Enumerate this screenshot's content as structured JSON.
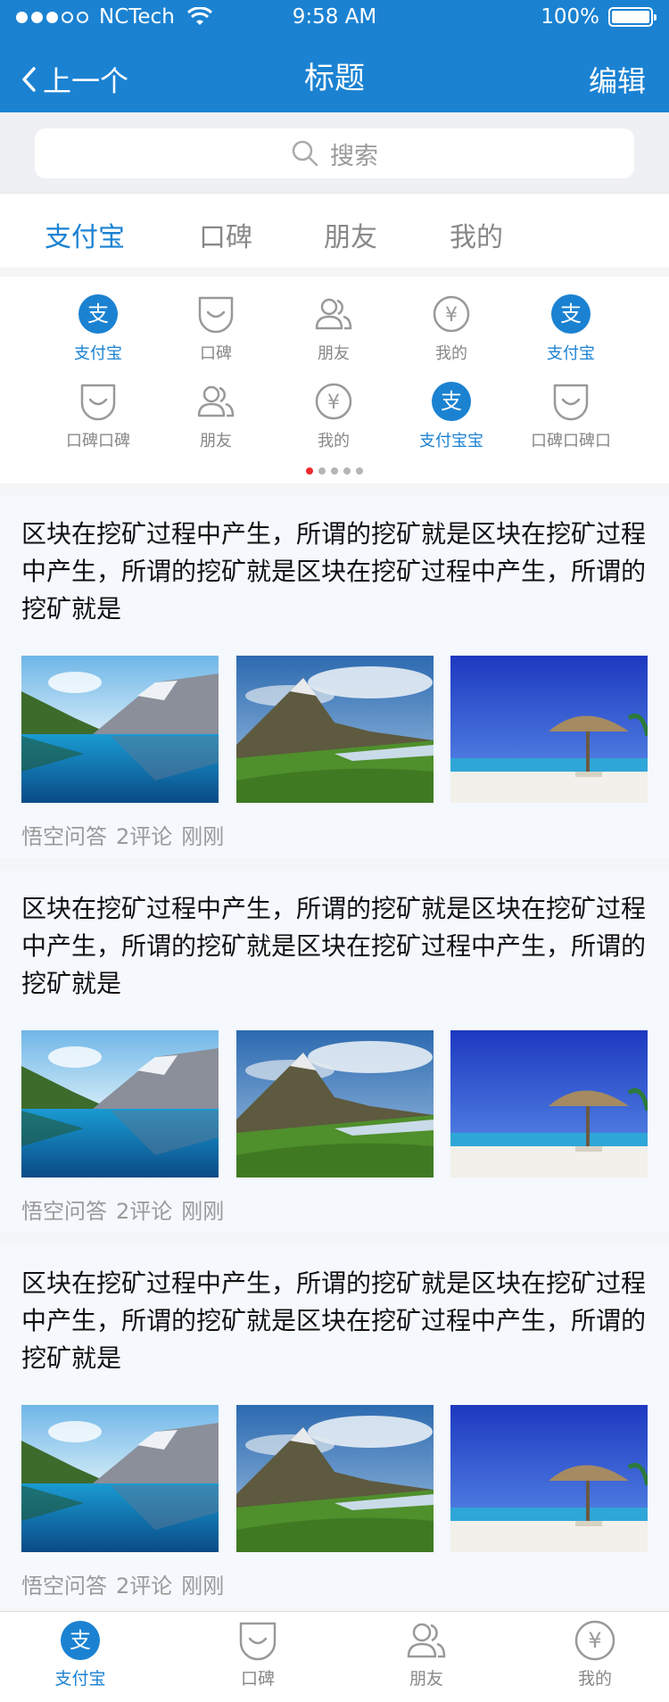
{
  "status_bar": {
    "carrier": "NCTech",
    "time": "9:58 AM",
    "battery": "100%"
  },
  "nav": {
    "back_label": "上一个",
    "title": "标题",
    "edit_label": "编辑"
  },
  "search": {
    "placeholder": "搜索"
  },
  "tabs": [
    {
      "label": "支付宝",
      "active": true
    },
    {
      "label": "口碑"
    },
    {
      "label": "朋友"
    },
    {
      "label": "我的"
    }
  ],
  "grid": {
    "items": [
      {
        "label": "支付宝",
        "icon": "alipay-icon",
        "active": true
      },
      {
        "label": "口碑",
        "icon": "koubei-icon"
      },
      {
        "label": "朋友",
        "icon": "friends-icon"
      },
      {
        "label": "我的",
        "icon": "yen-icon"
      },
      {
        "label": "支付宝",
        "icon": "alipay-icon",
        "active": true
      },
      {
        "label": "口碑口碑",
        "icon": "koubei-icon"
      },
      {
        "label": "朋友",
        "icon": "friends-icon"
      },
      {
        "label": "我的",
        "icon": "yen-icon"
      },
      {
        "label": "支付宝宝",
        "icon": "alipay-icon",
        "active": true
      },
      {
        "label": "口碑口碑口",
        "icon": "koubei-icon"
      }
    ],
    "page_count": 5,
    "current_page": 1
  },
  "feed": [
    {
      "text": "区块在挖矿过程中产生，所谓的挖矿就是区块在挖矿过程中产生，所谓的挖矿就是区块在挖矿过程中产生，所谓的挖矿就是",
      "source": "悟空问答",
      "comments": "2评论",
      "time": "刚刚",
      "images": [
        "lake-photo",
        "mountain-photo",
        "beach-photo"
      ]
    },
    {
      "text": "区块在挖矿过程中产生，所谓的挖矿就是区块在挖矿过程中产生，所谓的挖矿就是区块在挖矿过程中产生，所谓的挖矿就是",
      "source": "悟空问答",
      "comments": "2评论",
      "time": "刚刚",
      "images": [
        "lake-photo",
        "mountain-photo",
        "beach-photo"
      ]
    },
    {
      "text": "区块在挖矿过程中产生，所谓的挖矿就是区块在挖矿过程中产生，所谓的挖矿就是区块在挖矿过程中产生，所谓的挖矿就是",
      "source": "悟空问答",
      "comments": "2评论",
      "time": "刚刚",
      "images": [
        "lake-photo",
        "mountain-photo",
        "beach-photo"
      ]
    }
  ],
  "tabbar": [
    {
      "label": "支付宝",
      "icon": "alipay-icon",
      "active": true
    },
    {
      "label": "口碑",
      "icon": "koubei-icon"
    },
    {
      "label": "朋友",
      "icon": "friends-icon"
    },
    {
      "label": "我的",
      "icon": "yen-icon"
    }
  ],
  "colors": {
    "brand": "#1b82d2",
    "inactive": "#888888",
    "pager_active": "#ee2b2b"
  }
}
